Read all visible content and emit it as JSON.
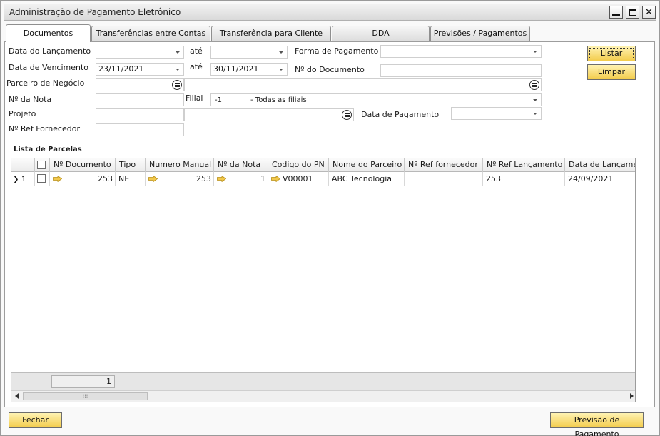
{
  "window": {
    "title": "Administração de Pagamento Eletrônico"
  },
  "tabs": [
    {
      "label": "Documentos",
      "active": true
    },
    {
      "label": "Transferências entre Contas",
      "active": false
    },
    {
      "label": "Transferência para Cliente",
      "active": false
    },
    {
      "label": "DDA",
      "active": false
    },
    {
      "label": "Previsões / Pagamentos",
      "active": false
    }
  ],
  "filters": {
    "data_lancamento": {
      "label": "Data do Lançamento",
      "from": "",
      "ate_label": "até",
      "to": ""
    },
    "data_vencimento": {
      "label": "Data de Vencimento",
      "from": "23/11/2021",
      "ate_label": "até",
      "to": "30/11/2021"
    },
    "forma_pagamento": {
      "label": "Forma de Pagamento",
      "value": ""
    },
    "num_documento": {
      "label": "Nº do Documento",
      "value": ""
    },
    "parceiro": {
      "label": "Parceiro de Negócio",
      "code": "",
      "name": ""
    },
    "num_nota": {
      "label": "Nº da Nota",
      "value": ""
    },
    "filial": {
      "label": "Filial",
      "code": "-1",
      "name": "- Todas as filiais"
    },
    "projeto": {
      "label": "Projeto",
      "code": "",
      "name": ""
    },
    "data_pagamento": {
      "label": "Data de Pagamento",
      "value": ""
    },
    "ref_fornecedor": {
      "label": "Nº Ref Fornecedor",
      "value": ""
    }
  },
  "buttons": {
    "listar": "Listar",
    "limpar": "Limpar",
    "fechar": "Fechar",
    "previsao": "Previsão de Pagamento"
  },
  "grid": {
    "title": "Lista de Parcelas",
    "columns": [
      "",
      "",
      "Nº Documento",
      "Tipo",
      "Numero Manual",
      "Nº da Nota",
      "Codigo do PN",
      "Nome do Parceiro",
      "Nº Ref fornecedor",
      "Nº Ref Lançamento",
      "Data de Lançamento"
    ],
    "rows": [
      {
        "index": "1",
        "selected_marker": "❯",
        "checked": false,
        "doc": "253",
        "tipo": "NE",
        "manual": "253",
        "nota": "1",
        "pn": "V00001",
        "parceiro": "ABC Tecnologia",
        "ref_forn": "",
        "ref_lanc": "253",
        "data_lanc": "24/09/2021"
      }
    ],
    "footer_count": "1"
  },
  "colors": {
    "button_top": "#fff3b3",
    "button_bottom": "#f3cc4c",
    "link_arrow": "#f2c84b"
  }
}
